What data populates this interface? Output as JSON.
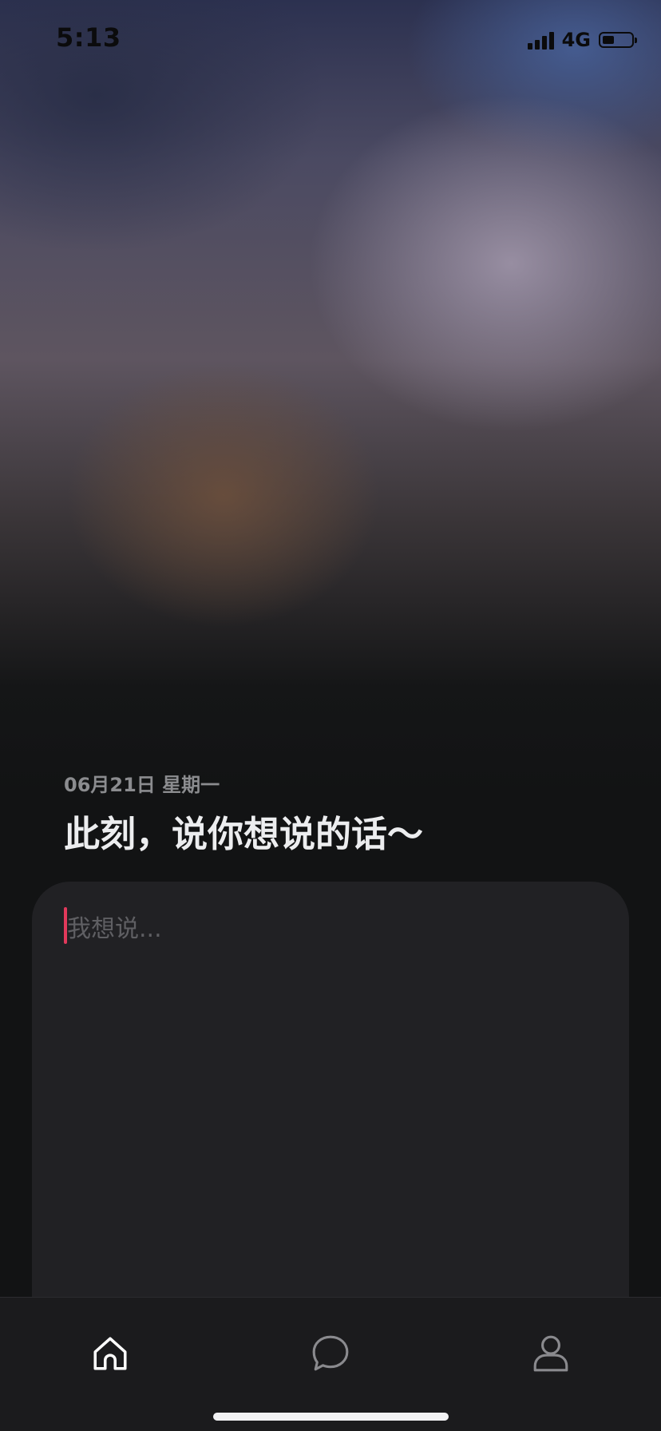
{
  "status_bar": {
    "time": "5:13",
    "network": "4G",
    "signal_bars": 4,
    "battery_level": 0.35
  },
  "header": {
    "date": "06月21日  星期一",
    "headline": "此刻，说你想说的话～"
  },
  "compose": {
    "placeholder": "我想说...",
    "value": ""
  },
  "tab_bar": {
    "items": [
      {
        "name": "home",
        "icon": "home-icon",
        "active": true
      },
      {
        "name": "messages",
        "icon": "chat-bubble-icon",
        "active": false
      },
      {
        "name": "profile",
        "icon": "user-icon",
        "active": false
      }
    ]
  },
  "colors": {
    "background": "#121314",
    "card": "#212124",
    "tab_bar": "#1b1b1d",
    "cursor": "#e2395b",
    "icon_active": "#ffffff",
    "icon_inactive": "#8a8a8e"
  }
}
